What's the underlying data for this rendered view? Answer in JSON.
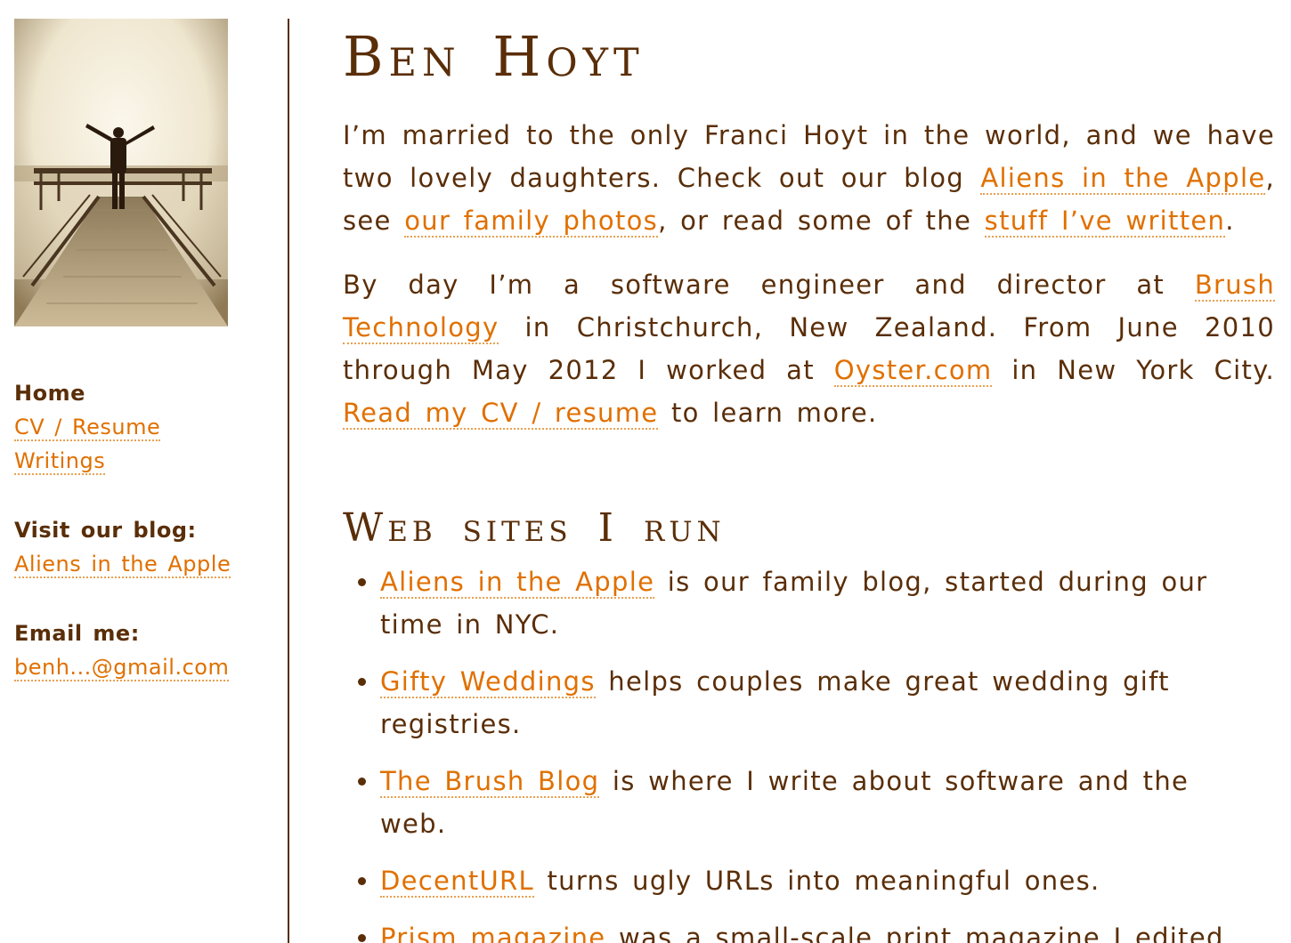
{
  "sidebar": {
    "photo_alt": "Ben Hoyt on a pier",
    "nav": {
      "home": "Home",
      "cv": "CV / Resume",
      "writings": "Writings"
    },
    "blog": {
      "heading": "Visit our blog:",
      "link": "Aliens in the Apple"
    },
    "email": {
      "heading": "Email me:",
      "link": "benh...@gmail.com"
    }
  },
  "main": {
    "title": "Ben Hoyt",
    "intro": {
      "t1": "I’m married to the only Franci Hoyt in the world, and we have two lovely daughters. Check out our blog ",
      "l1": "Aliens in the Apple",
      "t2": ", see ",
      "l2": "our family photos",
      "t3": ", or read some of the ",
      "l3": "stuff I’ve written",
      "t4": "."
    },
    "work": {
      "t1": "By day I’m a software engineer and director at ",
      "l1": "Brush Technology",
      "t2": " in Christchurch, New Zealand. From June 2010 through May 2012 I worked at ",
      "l2": "Oyster.com",
      "t3": " in New York City. ",
      "l3": "Read my CV / resume",
      "t4": " to learn more."
    },
    "sites_heading": "Web sites I run",
    "sites": [
      {
        "link": "Aliens in the Apple",
        "text": " is our family blog, started during our time in NYC."
      },
      {
        "link": "Gifty Weddings",
        "text": " helps couples make great wedding gift registries."
      },
      {
        "link": "The Brush Blog",
        "text": " is where I write about software and the web."
      },
      {
        "link": "DecentURL",
        "text": " turns ugly URLs into meaningful ones."
      },
      {
        "link": "Prism magazine",
        "text": " was a small-scale print magazine I edited."
      }
    ]
  }
}
